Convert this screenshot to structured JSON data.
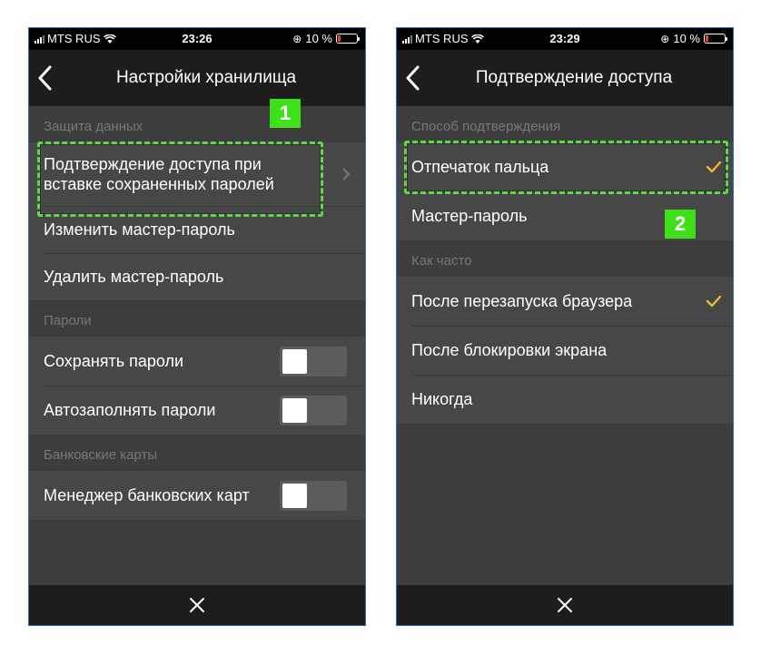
{
  "colors": {
    "accent_check": "#f5b731",
    "highlight": "#5fd847",
    "badge": "#3fe01a",
    "background": "#3d3d3d",
    "row": "#474747",
    "nav": "#1d1d1d"
  },
  "left": {
    "status": {
      "carrier": "MTS RUS",
      "time": "23:26",
      "battery": "10 %"
    },
    "nav": {
      "title": "Настройки хранилища"
    },
    "sections": {
      "data_protection": "Защита данных",
      "passwords": "Пароли",
      "bank_cards": "Банковские карты"
    },
    "rows": {
      "access_confirm": "Подтверждение доступа при вставке сохраненных паролей",
      "change_master": "Изменить мастер-пароль",
      "delete_master": "Удалить мастер-пароль",
      "save_passwords": "Сохранять пароли",
      "autofill_passwords": "Автозаполнять пароли",
      "card_manager": "Менеджер банковских карт"
    },
    "badge": "1"
  },
  "right": {
    "status": {
      "carrier": "MTS RUS",
      "time": "23:29",
      "battery": "10 %"
    },
    "nav": {
      "title": "Подтверждение доступа"
    },
    "sections": {
      "method": "Способ подтверждения",
      "how_often": "Как часто"
    },
    "rows": {
      "fingerprint": "Отпечаток пальца",
      "master_password": "Мастер-пароль",
      "after_restart": "После перезапуска браузера",
      "after_lock": "После блокировки экрана",
      "never": "Никогда"
    },
    "badge": "2"
  }
}
